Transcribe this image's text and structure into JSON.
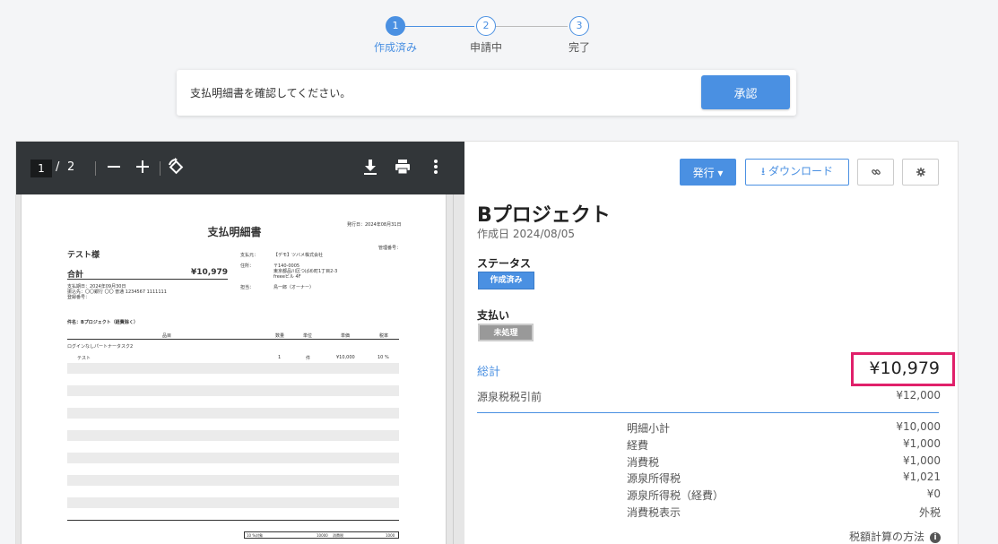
{
  "stepper": {
    "steps": [
      {
        "num": "1",
        "label": "作成済み"
      },
      {
        "num": "2",
        "label": "申請中"
      },
      {
        "num": "3",
        "label": "完了"
      }
    ]
  },
  "confirm": {
    "message": "支払明細書を確認してください。",
    "approve_label": "承認"
  },
  "pdf": {
    "current_page": "1",
    "separator": "/",
    "total_pages": "2",
    "document": {
      "title": "支払明細書",
      "issue_date": "発行日：2024年08月31日",
      "mgmt_no": "管理番号：",
      "addressee": "テスト様",
      "total_label": "合計",
      "total_value": "¥10,979",
      "pay_info_1": "支払期日：2024年09月30日",
      "pay_info_2": "振込先：〇〇銀行 〇〇 普通 1234567 1111111",
      "pay_info_3": "登録番号：",
      "payer_label": "支払元：",
      "payer_value": "【デモ】ツバメ株式会社",
      "addr_label": "住所：",
      "addr_line1": "〒140-0005",
      "addr_line2": "東京都品川区つばめ町1丁目2-3",
      "addr_line3": "freeeビル 4F",
      "person_label": "担当：",
      "person_value": "鳥一郎（オーナー）",
      "subject": "件名：Bプロジェクト（経費除く）",
      "headers": [
        "品目",
        "数量",
        "単位",
        "単価",
        "税率"
      ],
      "group_row": "ログインなしパートナータスク2",
      "item_row": {
        "name": "テスト",
        "qty": "1",
        "unit": "件",
        "price": "¥10,000",
        "tax": "10 %"
      },
      "tax_row": {
        "label": "10 %対象",
        "amount": "10000",
        "tax_label": "消費税",
        "tax_amount": "1000"
      }
    }
  },
  "detail": {
    "issue_button": "発行 ▾",
    "download_button": "ダウンロード",
    "project_title": "Bプロジェクト",
    "created": "作成日 2024/08/05",
    "status_label": "ステータス",
    "status_badge": "作成済み",
    "payment_label": "支払い",
    "payment_badge": "未処理",
    "total_label": "総計",
    "total_value": "¥10,979",
    "pre_withholding_label": "源泉税税引前",
    "pre_withholding_value": "¥12,000",
    "breakdown": [
      {
        "label": "明細小計",
        "value": "¥10,000"
      },
      {
        "label": "経費",
        "value": "¥1,000"
      },
      {
        "label": "消費税",
        "value": "¥1,000"
      },
      {
        "label": "源泉所得税",
        "value": "¥1,021"
      },
      {
        "label": "源泉所得税（経費）",
        "value": "¥0"
      },
      {
        "label": "消費税表示",
        "value": "外税"
      }
    ],
    "tax_method": "税額計算の方法",
    "colors": {
      "accent": "#4a90e2",
      "highlight": "#e0206a"
    }
  }
}
